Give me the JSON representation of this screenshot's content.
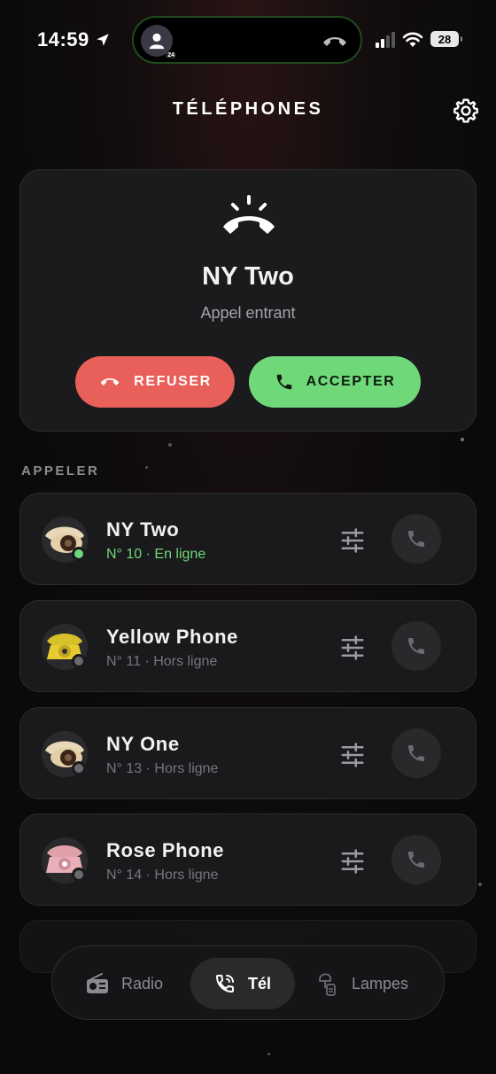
{
  "status_bar": {
    "time": "14:59",
    "battery": "28",
    "island_badge": "24"
  },
  "header": {
    "title": "TÉLÉPHONES"
  },
  "incoming": {
    "caller_name": "NY Two",
    "status": "Appel entrant",
    "refuse_label": "REFUSER",
    "accept_label": "ACCEPTER"
  },
  "section": {
    "label": "APPELER"
  },
  "phones": [
    {
      "name": "NY Two",
      "meta": "N° 10 · En ligne",
      "online": true
    },
    {
      "name": "Yellow Phone",
      "meta": "N° 11 · Hors ligne",
      "online": false
    },
    {
      "name": "NY One",
      "meta": "N° 13 · Hors ligne",
      "online": false
    },
    {
      "name": "Rose Phone",
      "meta": "N° 14 · Hors ligne",
      "online": false
    }
  ],
  "nav": {
    "radio": "Radio",
    "tel": "Tél",
    "lamps": "Lampes",
    "active": "tel"
  },
  "colors": {
    "accept": "#6fd97a",
    "refuse": "#e95f5a",
    "online": "#6fd97a",
    "offline": "#6a6a6e"
  }
}
